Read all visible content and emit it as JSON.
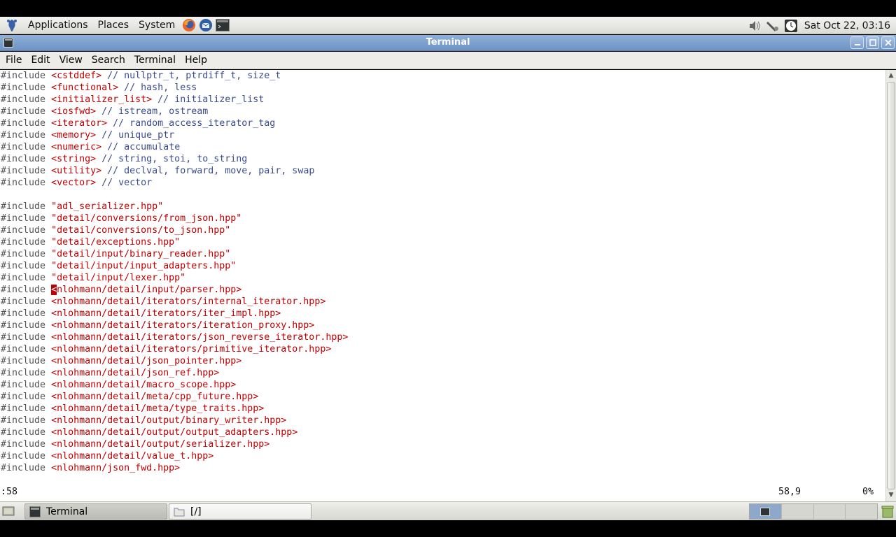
{
  "top_panel": {
    "menus": [
      "Applications",
      "Places",
      "System"
    ],
    "launchers": [
      "firefox-icon",
      "thunderbird-icon",
      "terminal-launcher-icon"
    ],
    "tray_icons": [
      "volume-icon",
      "network-icon",
      "clock-icon"
    ],
    "clock": "Sat Oct 22, 03:16"
  },
  "window": {
    "title": "Terminal"
  },
  "menubar": {
    "items": [
      "File",
      "Edit",
      "View",
      "Search",
      "Terminal",
      "Help"
    ]
  },
  "editor": {
    "lines": [
      {
        "kw": "#include ",
        "path": "<cstddef>",
        "cmt": " // nullptr_t, ptrdiff_t, size_t"
      },
      {
        "kw": "#include ",
        "path": "<functional>",
        "cmt": " // hash, less"
      },
      {
        "kw": "#include ",
        "path": "<initializer_list>",
        "cmt": " // initializer_list"
      },
      {
        "kw": "#include ",
        "path": "<iosfwd>",
        "cmt": " // istream, ostream"
      },
      {
        "kw": "#include ",
        "path": "<iterator>",
        "cmt": " // random_access_iterator_tag"
      },
      {
        "kw": "#include ",
        "path": "<memory>",
        "cmt": " // unique_ptr"
      },
      {
        "kw": "#include ",
        "path": "<numeric>",
        "cmt": " // accumulate"
      },
      {
        "kw": "#include ",
        "path": "<string>",
        "cmt": " // string, stoi, to_string"
      },
      {
        "kw": "#include ",
        "path": "<utility>",
        "cmt": " // declval, forward, move, pair, swap"
      },
      {
        "kw": "#include ",
        "path": "<vector>",
        "cmt": " // vector"
      },
      {
        "kw": "",
        "path": "",
        "cmt": ""
      },
      {
        "kw": "#include ",
        "path": "\"adl_serializer.hpp\"",
        "cmt": ""
      },
      {
        "kw": "#include ",
        "path": "\"detail/conversions/from_json.hpp\"",
        "cmt": ""
      },
      {
        "kw": "#include ",
        "path": "\"detail/conversions/to_json.hpp\"",
        "cmt": ""
      },
      {
        "kw": "#include ",
        "path": "\"detail/exceptions.hpp\"",
        "cmt": ""
      },
      {
        "kw": "#include ",
        "path": "\"detail/input/binary_reader.hpp\"",
        "cmt": ""
      },
      {
        "kw": "#include ",
        "path": "\"detail/input/input_adapters.hpp\"",
        "cmt": ""
      },
      {
        "kw": "#include ",
        "path": "\"detail/input/lexer.hpp\"",
        "cmt": ""
      },
      {
        "kw": "#include ",
        "cursor": "<",
        "path": "nlohmann/detail/input/parser.hpp>",
        "cmt": ""
      },
      {
        "kw": "#include ",
        "path": "<nlohmann/detail/iterators/internal_iterator.hpp>",
        "cmt": ""
      },
      {
        "kw": "#include ",
        "path": "<nlohmann/detail/iterators/iter_impl.hpp>",
        "cmt": ""
      },
      {
        "kw": "#include ",
        "path": "<nlohmann/detail/iterators/iteration_proxy.hpp>",
        "cmt": ""
      },
      {
        "kw": "#include ",
        "path": "<nlohmann/detail/iterators/json_reverse_iterator.hpp>",
        "cmt": ""
      },
      {
        "kw": "#include ",
        "path": "<nlohmann/detail/iterators/primitive_iterator.hpp>",
        "cmt": ""
      },
      {
        "kw": "#include ",
        "path": "<nlohmann/detail/json_pointer.hpp>",
        "cmt": ""
      },
      {
        "kw": "#include ",
        "path": "<nlohmann/detail/json_ref.hpp>",
        "cmt": ""
      },
      {
        "kw": "#include ",
        "path": "<nlohmann/detail/macro_scope.hpp>",
        "cmt": ""
      },
      {
        "kw": "#include ",
        "path": "<nlohmann/detail/meta/cpp_future.hpp>",
        "cmt": ""
      },
      {
        "kw": "#include ",
        "path": "<nlohmann/detail/meta/type_traits.hpp>",
        "cmt": ""
      },
      {
        "kw": "#include ",
        "path": "<nlohmann/detail/output/binary_writer.hpp>",
        "cmt": ""
      },
      {
        "kw": "#include ",
        "path": "<nlohmann/detail/output/output_adapters.hpp>",
        "cmt": ""
      },
      {
        "kw": "#include ",
        "path": "<nlohmann/detail/output/serializer.hpp>",
        "cmt": ""
      },
      {
        "kw": "#include ",
        "path": "<nlohmann/detail/value_t.hpp>",
        "cmt": ""
      },
      {
        "kw": "#include ",
        "path": "<nlohmann/json_fwd.hpp>",
        "cmt": ""
      }
    ],
    "status": {
      "command": ":58",
      "position": "58,9",
      "percent": "0%"
    }
  },
  "taskbar": {
    "tasks": [
      "Terminal",
      "[/]"
    ]
  },
  "colors": {
    "path": "#c00000",
    "comment": "#3a4d8c",
    "titlebar": "#7c9ccc"
  }
}
